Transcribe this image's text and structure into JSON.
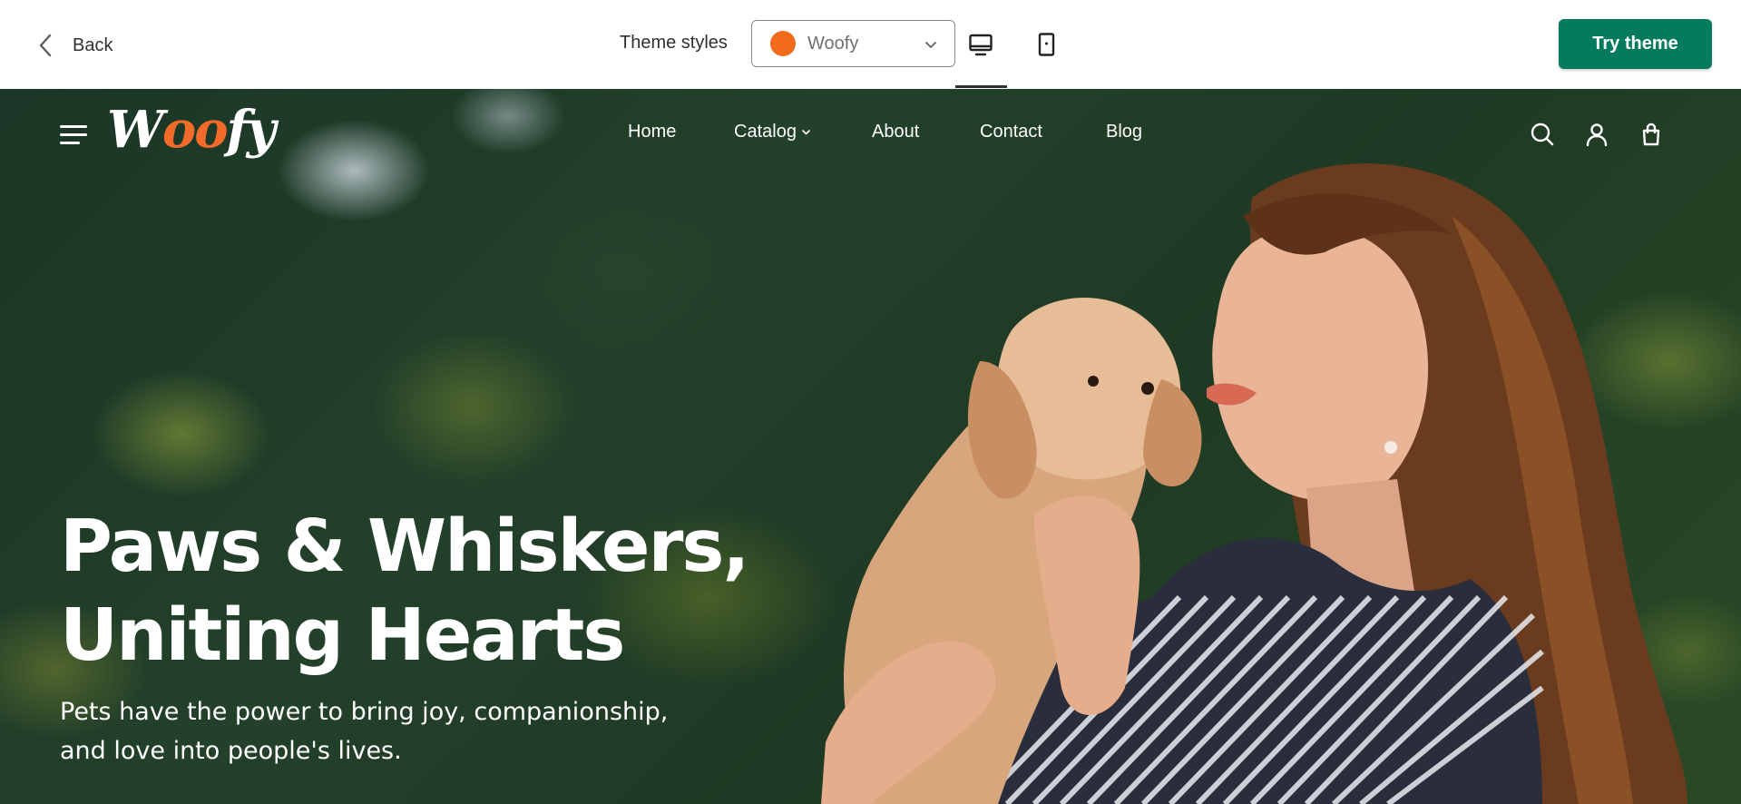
{
  "topbar": {
    "back_label": "Back",
    "theme_styles_label": "Theme styles",
    "theme_style_select": {
      "selected": "Woofy",
      "swatch_color": "#f26b1d"
    },
    "devices": [
      "desktop",
      "mobile"
    ],
    "active_device": "desktop",
    "try_theme_label": "Try theme",
    "try_theme_color": "#047b5d"
  },
  "store": {
    "logo": {
      "part1": "W",
      "part2": "oo",
      "part3": "fy",
      "accent_color": "#f26b2a"
    },
    "nav": [
      {
        "label": "Home"
      },
      {
        "label": "Catalog",
        "has_dropdown": true
      },
      {
        "label": "About"
      },
      {
        "label": "Contact"
      },
      {
        "label": "Blog"
      }
    ],
    "header_icons": [
      "search-icon",
      "account-icon",
      "cart-icon"
    ]
  },
  "hero": {
    "title_line1": "Paws & Whiskers,",
    "title_line2": "Uniting Hearts",
    "subtitle_line1": "Pets have the power to bring joy, companionship,",
    "subtitle_line2": "and love into people's lives."
  }
}
